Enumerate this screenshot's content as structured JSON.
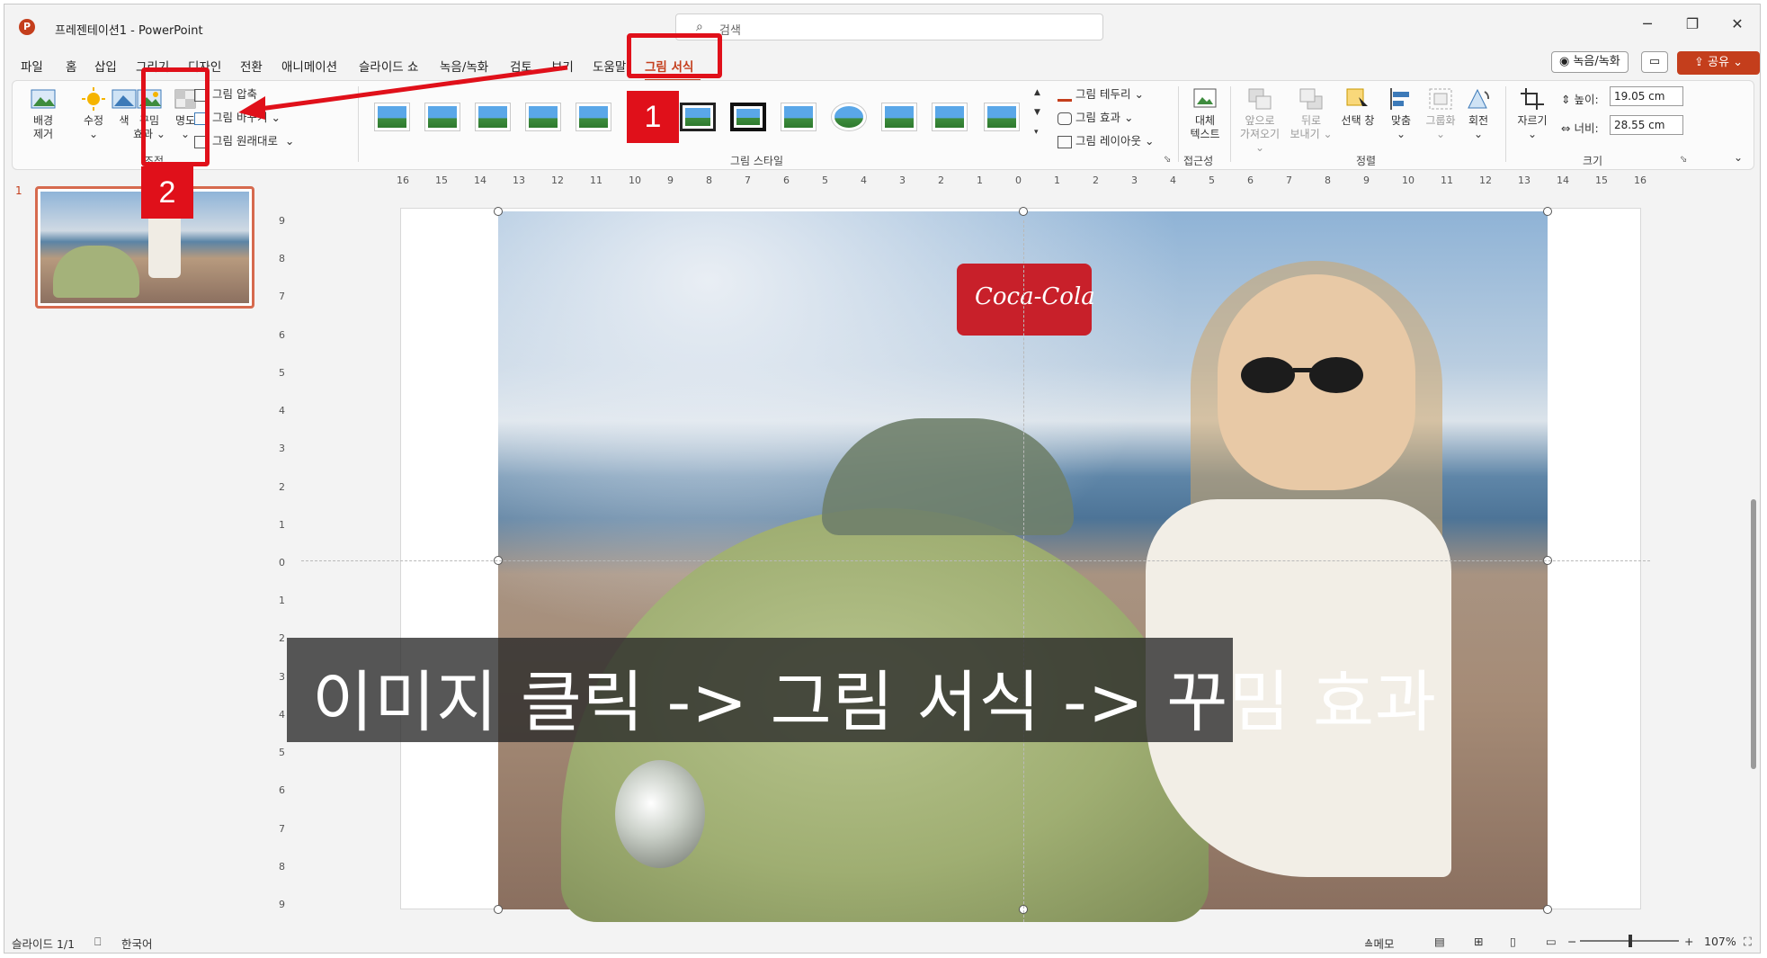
{
  "window": {
    "doc_title": "프레젠테이션1  -  PowerPoint",
    "search_placeholder": "검색",
    "app_logo": "P"
  },
  "menu": {
    "tabs": [
      "파일",
      "홈",
      "삽입",
      "그리기",
      "디자인",
      "전환",
      "애니메이션",
      "슬라이드 쇼",
      "녹음/녹화",
      "검토",
      "보기",
      "도움말",
      "그림 서식"
    ],
    "active_tab": "그림 서식",
    "record_button": "◉ 녹음/녹화",
    "share_button": "공유"
  },
  "ribbon": {
    "adjust": {
      "remove_bg": [
        "배경",
        "제거"
      ],
      "corrections": "수정",
      "color": "색",
      "artistic_effects": [
        "꾸밈",
        "효과"
      ],
      "transparency": "명도",
      "compress": "그림 압축",
      "change_picture": "그림 바꾸기",
      "reset_picture": "그림 원래대로",
      "group_label": "조정"
    },
    "styles": {
      "group_label": "그림 스타일",
      "border": "그림 테두리",
      "effects": "그림 효과",
      "layout": "그림 레이아웃"
    },
    "accessibility": {
      "alt_text": [
        "대체",
        "텍스트"
      ],
      "group_label": "접근성"
    },
    "arrange": {
      "bring_forward": [
        "앞으로",
        "가져오기"
      ],
      "send_backward": [
        "뒤로",
        "보내기"
      ],
      "selection_pane": "선택 창",
      "align": "맞춤",
      "group": "그룹화",
      "rotate": "회전",
      "group_label": "정렬"
    },
    "size": {
      "crop": "자르기",
      "height_label": "높이:",
      "height_value": "19.05 cm",
      "width_label": "너비:",
      "width_value": "28.55 cm",
      "group_label": "크기"
    }
  },
  "annotations": {
    "badge1": "1",
    "badge2": "2",
    "caption": "이미지 클릭 -> 그림 서식 -> 꾸밈 효과",
    "highlight_color": "#e0101a"
  },
  "slides_panel": {
    "slide_number": "1"
  },
  "slide": {
    "cooler_logo": "Coca-Cola"
  },
  "rulers": {
    "horizontal": [
      "16",
      "15",
      "14",
      "13",
      "12",
      "11",
      "10",
      "9",
      "8",
      "7",
      "6",
      "5",
      "4",
      "3",
      "2",
      "1",
      "0",
      "1",
      "2",
      "3",
      "4",
      "5",
      "6",
      "7",
      "8",
      "9",
      "10",
      "11",
      "12",
      "13",
      "14",
      "15",
      "16"
    ],
    "vertical": [
      "9",
      "8",
      "7",
      "6",
      "5",
      "4",
      "3",
      "2",
      "1",
      "0",
      "1",
      "2",
      "3",
      "4",
      "5",
      "6",
      "7",
      "8",
      "9"
    ]
  },
  "status": {
    "slide_info": "슬라이드 1/1",
    "language": "한국어",
    "notes": "메모",
    "zoom": "107%"
  },
  "colors": {
    "accent": "#c43e1c",
    "annotation_red": "#e0101a"
  }
}
